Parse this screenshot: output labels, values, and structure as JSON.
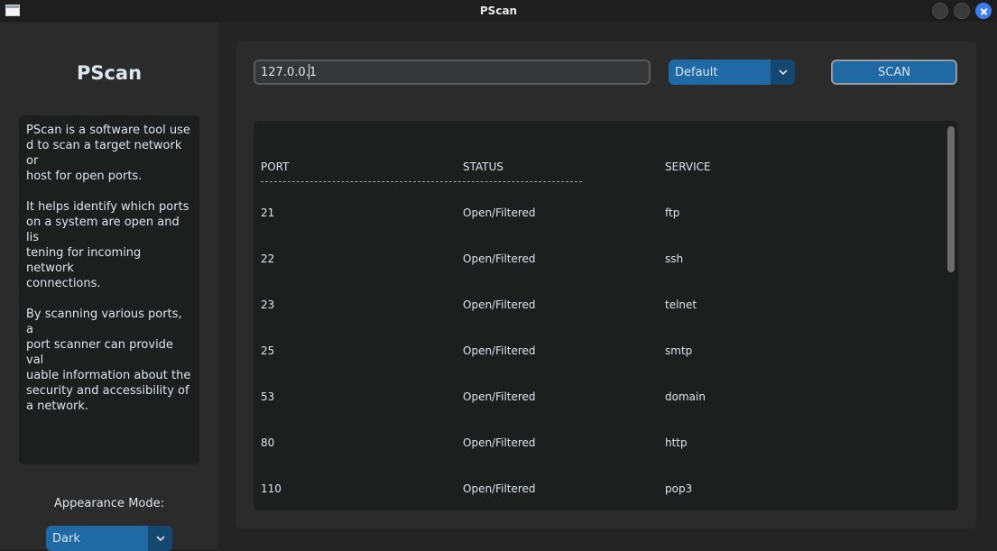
{
  "window": {
    "title": "PScan"
  },
  "sidebar": {
    "brand": "PScan",
    "description": "PScan is a software tool use\nd to scan a target network or\nhost for open ports.\n\n It helps identify which ports\non a system are open and lis\ntening for incoming network\nconnections.\n\n By scanning various ports, a\nport scanner can provide val\nuable information about the\nsecurity and accessibility of\na network.",
    "appearance_label": "Appearance Mode:",
    "appearance_value": "Dark"
  },
  "toolbar": {
    "target_value": "127.0.0.1",
    "profile_value": "Default",
    "scan_label": "SCAN"
  },
  "results": {
    "headers": [
      "PORT",
      "STATUS",
      "SERVICE"
    ],
    "rows": [
      [
        "21",
        "Open/Filtered",
        "ftp"
      ],
      [
        "22",
        "Open/Filtered",
        "ssh"
      ],
      [
        "23",
        "Open/Filtered",
        "telnet"
      ],
      [
        "25",
        "Open/Filtered",
        "smtp"
      ],
      [
        "53",
        "Open/Filtered",
        "domain"
      ],
      [
        "80",
        "Open/Filtered",
        "http"
      ],
      [
        "110",
        "Open/Filtered",
        "pop3"
      ]
    ]
  },
  "colors": {
    "accent": "#1f6aa5",
    "accent_dark": "#144870",
    "panel": "#2b2b2b",
    "textbox": "#1d1e1e"
  },
  "icons": {
    "window": "app-window-icon",
    "dropdown": "chevron-down-icon"
  }
}
